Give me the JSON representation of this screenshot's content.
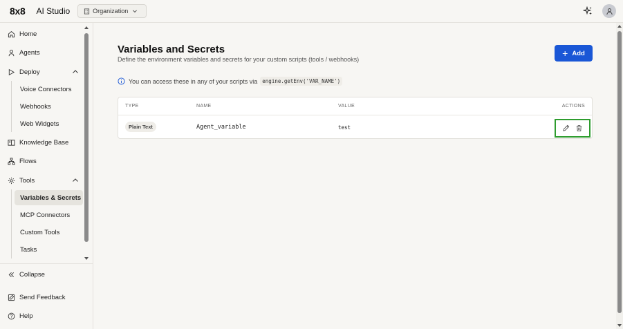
{
  "header": {
    "logo": "8x8",
    "app_title": "AI Studio",
    "org_selector": "Organization"
  },
  "sidebar": {
    "items": [
      {
        "label": "Home",
        "icon": "home-icon"
      },
      {
        "label": "Agents",
        "icon": "person-icon"
      },
      {
        "label": "Deploy",
        "icon": "play-icon",
        "expanded": true
      },
      {
        "label": "Voice Connectors"
      },
      {
        "label": "Webhooks"
      },
      {
        "label": "Web Widgets"
      },
      {
        "label": "Knowledge Base",
        "icon": "book-icon"
      },
      {
        "label": "Flows",
        "icon": "flows-icon"
      },
      {
        "label": "Tools",
        "icon": "gear-icon",
        "expanded": true
      },
      {
        "label": "Variables & Secrets",
        "active": true
      },
      {
        "label": "MCP Connectors"
      },
      {
        "label": "Custom Tools"
      },
      {
        "label": "Tasks"
      }
    ],
    "collapse_label": "Collapse",
    "feedback_label": "Send Feedback",
    "help_label": "Help"
  },
  "page": {
    "title": "Variables and Secrets",
    "subtitle": "Define the environment variables and secrets for your custom scripts (tools / webhooks)",
    "add_label": "Add",
    "info_text": "You can access these in any of your scripts via",
    "info_code": "engine.getEnv('VAR_NAME')"
  },
  "table": {
    "headers": {
      "type": "TYPE",
      "name": "NAME",
      "value": "VALUE",
      "actions": "ACTIONS"
    },
    "rows": [
      {
        "type": "Plain Text",
        "name": "Agent_variable",
        "value": "test"
      }
    ]
  },
  "colors": {
    "accent": "#1a57d6",
    "highlight": "#2e9c2e",
    "background": "#f7f6f3"
  }
}
